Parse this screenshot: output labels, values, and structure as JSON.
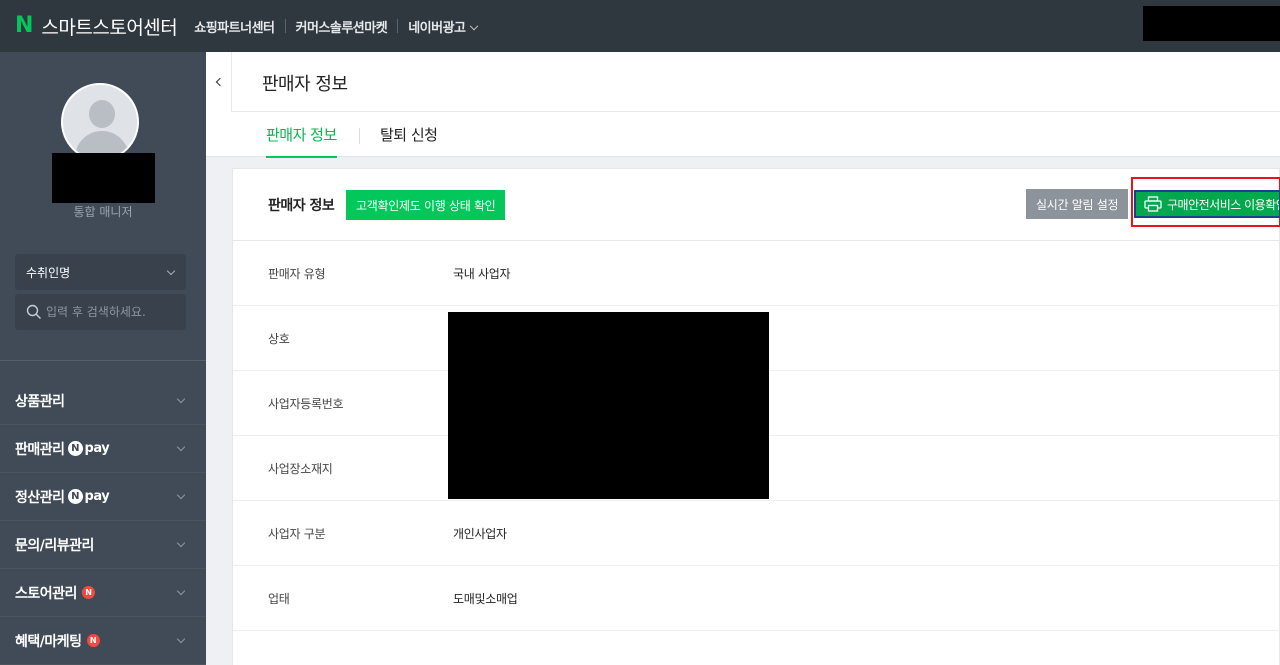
{
  "app": {
    "logo_letter": "N",
    "title": "스마트스토어센터"
  },
  "topnav": {
    "items": [
      {
        "label": "쇼핑파트너센터"
      },
      {
        "label": "커머스솔루션마켓"
      },
      {
        "label": "네이버광고"
      }
    ]
  },
  "sidebar": {
    "role": "통합 매니저",
    "store_select": "수취인명",
    "search_placeholder": "입력 후 검색하세요.",
    "menu": [
      {
        "label": "상품관리"
      },
      {
        "label": "판매관리",
        "badge_n": "N",
        "badge_text": "pay"
      },
      {
        "label": "정산관리",
        "badge_n": "N",
        "badge_text": "pay"
      },
      {
        "label": "문의/리뷰관리"
      },
      {
        "label": "스토어관리",
        "new_badge": "N"
      },
      {
        "label": "혜택/마케팅",
        "new_badge": "N"
      }
    ]
  },
  "page": {
    "title": "판매자 정보",
    "tabs": [
      {
        "label": "판매자 정보",
        "active": true
      },
      {
        "label": "탈퇴 신청",
        "active": false
      }
    ]
  },
  "card": {
    "title": "판매자 정보",
    "status_button": "고객확인제도 이행 상태 확인",
    "alert_button": "실시간 알림 설정",
    "safe_service_button": "구매안전서비스 이용확인",
    "rows": [
      {
        "label": "판매자 유형",
        "value": "국내 사업자"
      },
      {
        "label": "상호",
        "value": ""
      },
      {
        "label": "사업자등록번호",
        "value": ""
      },
      {
        "label": "사업장소재지",
        "value": ""
      },
      {
        "label": "사업자 구분",
        "value": "개인사업자"
      },
      {
        "label": "업태",
        "value": "도매및소매업"
      }
    ]
  },
  "colors": {
    "brand_green": "#03c75a",
    "topbar_bg": "#2f373f",
    "sidebar_bg": "#414b57",
    "highlight_red": "#e8151b"
  },
  "icons": [
    "chevron-down-icon",
    "search-icon",
    "chevron-left-icon",
    "printer-icon",
    "user-avatar-icon"
  ]
}
